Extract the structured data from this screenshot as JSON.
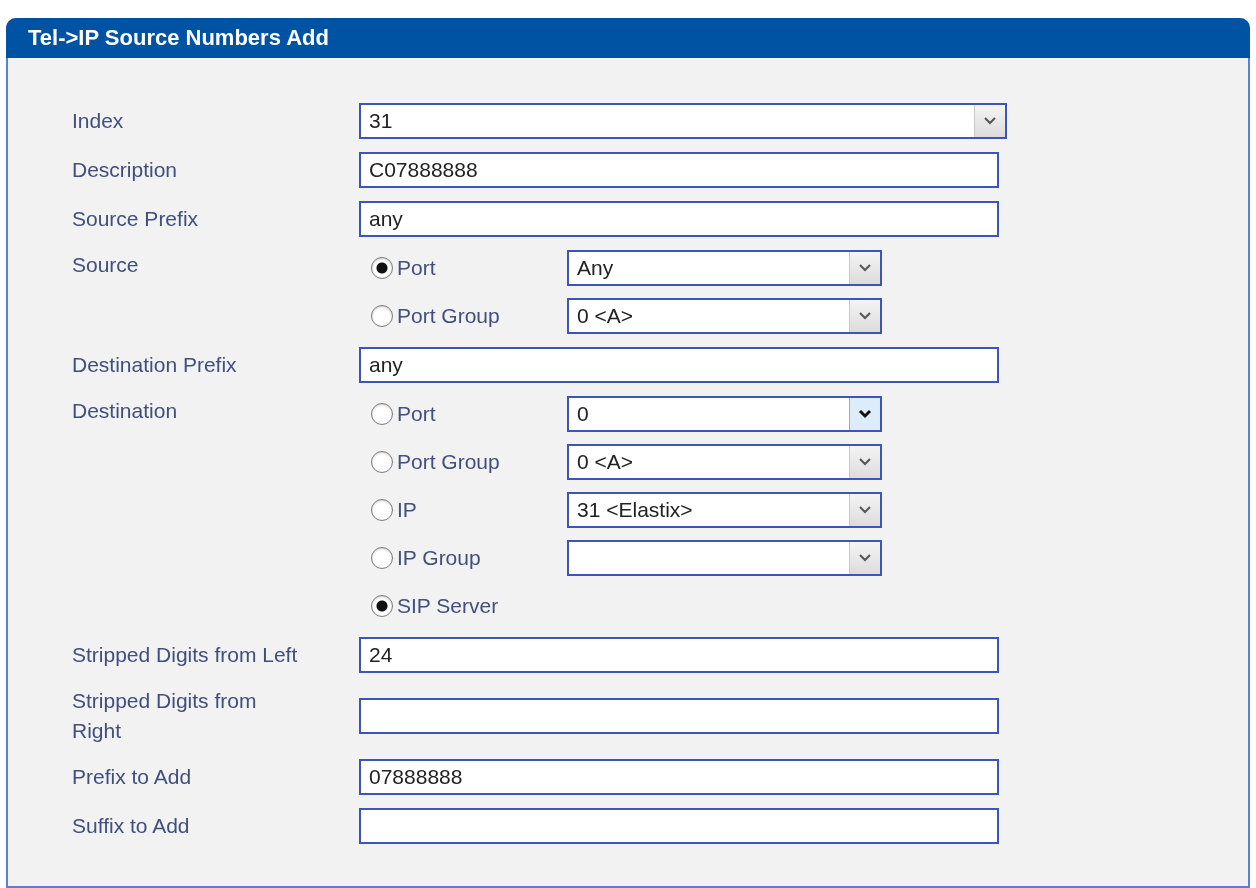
{
  "panel": {
    "title": "Tel->IP Source Numbers Add"
  },
  "fields": [
    {
      "kind": "select",
      "label": "Index",
      "value": "31"
    },
    {
      "kind": "text",
      "label": "Description",
      "value": "C07888888"
    },
    {
      "kind": "text",
      "label": "Source Prefix",
      "value": "any"
    },
    {
      "kind": "radio_group",
      "label": "Source",
      "options": [
        {
          "label": "Port",
          "selected": true,
          "select": {
            "value": "Any",
            "focused": false
          }
        },
        {
          "label": "Port Group",
          "selected": false,
          "select": {
            "value": "0 <A>",
            "focused": false
          }
        }
      ]
    },
    {
      "kind": "text",
      "label": "Destination Prefix",
      "value": "any"
    },
    {
      "kind": "radio_group",
      "label": "Destination",
      "options": [
        {
          "label": "Port",
          "selected": false,
          "select": {
            "value": "0",
            "focused": true
          }
        },
        {
          "label": "Port Group",
          "selected": false,
          "select": {
            "value": "0 <A>",
            "focused": false
          }
        },
        {
          "label": "IP",
          "selected": false,
          "select": {
            "value": "31 <Elastix>",
            "focused": false
          }
        },
        {
          "label": "IP Group",
          "selected": false,
          "select": {
            "focused": false
          }
        },
        {
          "label": "SIP Server",
          "selected": true
        }
      ]
    },
    {
      "kind": "text",
      "label": "Stripped Digits from Left",
      "value": "24"
    },
    {
      "kind": "text",
      "label": "Stripped Digits from Right"
    },
    {
      "kind": "text",
      "label": "Prefix to Add",
      "value": "07888888"
    },
    {
      "kind": "text",
      "label": "Suffix to Add"
    }
  ]
}
